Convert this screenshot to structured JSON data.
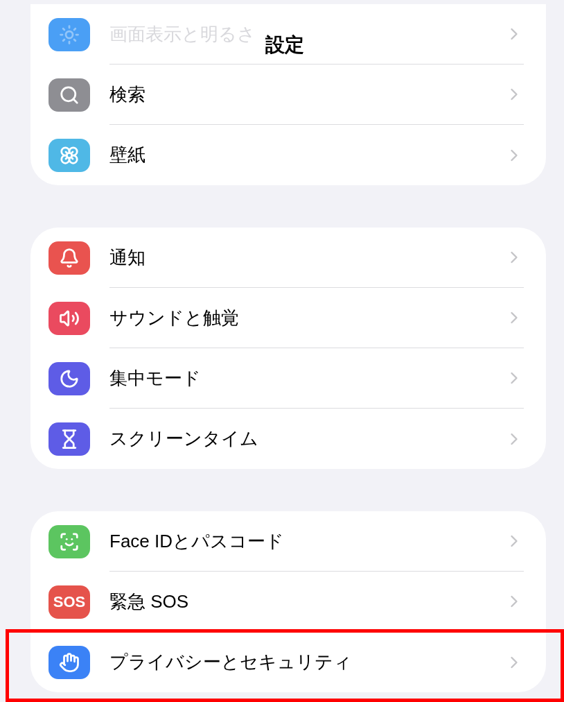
{
  "title": "設定",
  "groups": [
    {
      "rows": [
        {
          "label": "画面表示と明るさ",
          "color": "#4a9ff5",
          "faded": true,
          "highlighted": false
        },
        {
          "label": "検索",
          "color": "#8e8e93",
          "faded": false,
          "highlighted": false
        },
        {
          "label": "壁紙",
          "color": "#4fb8e6",
          "faded": false,
          "highlighted": false
        }
      ]
    },
    {
      "rows": [
        {
          "label": "通知",
          "color": "#e9534f",
          "faded": false,
          "highlighted": false
        },
        {
          "label": "サウンドと触覚",
          "color": "#ea4a5f",
          "faded": false,
          "highlighted": false
        },
        {
          "label": "集中モード",
          "color": "#5e5ce6",
          "faded": false,
          "highlighted": false
        },
        {
          "label": "スクリーンタイム",
          "color": "#5e5ce6",
          "faded": false,
          "highlighted": false
        }
      ]
    },
    {
      "rows": [
        {
          "label": "Face IDとパスコード",
          "color": "#5cc560",
          "faded": false,
          "highlighted": false
        },
        {
          "label": "緊急 SOS",
          "color": "#e5534b",
          "faded": false,
          "highlighted": false,
          "icon_text": "SOS"
        },
        {
          "label": "プライバシーとセキュリティ",
          "color": "#3b82f6",
          "faded": false,
          "highlighted": true
        }
      ]
    }
  ]
}
